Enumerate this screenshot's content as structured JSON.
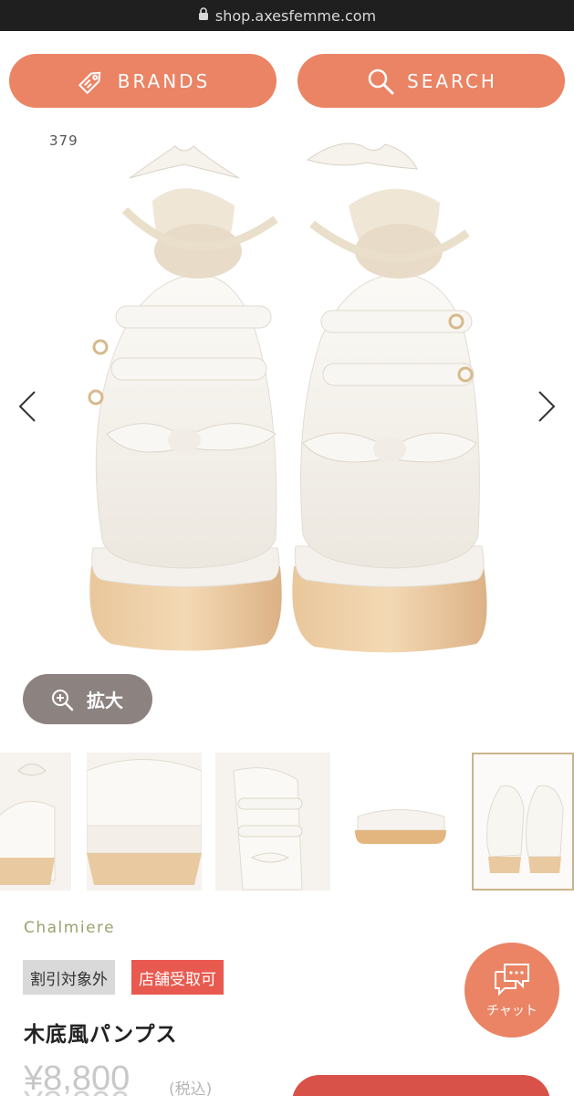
{
  "browser": {
    "url": "shop.axesfemme.com"
  },
  "header": {
    "brands_label": "BRANDS",
    "search_label": "SEARCH"
  },
  "gallery": {
    "counter": "379",
    "zoom_label": "拡大",
    "thumbnail_count": 5,
    "active_thumbnail": 5
  },
  "product": {
    "brand": "Chalmiere",
    "tags": [
      "割引対象外",
      "店舗受取可"
    ],
    "name": "木底風パンプス",
    "price": "¥8,800",
    "tax_note": "(税込)",
    "price_repeat": "¥8,800"
  },
  "chat": {
    "label": "チャット"
  },
  "colors": {
    "accent": "#ea8465",
    "tag_red": "#e85a4f",
    "brand_green": "#9aa36d",
    "zoom_bg": "#8c8280"
  }
}
